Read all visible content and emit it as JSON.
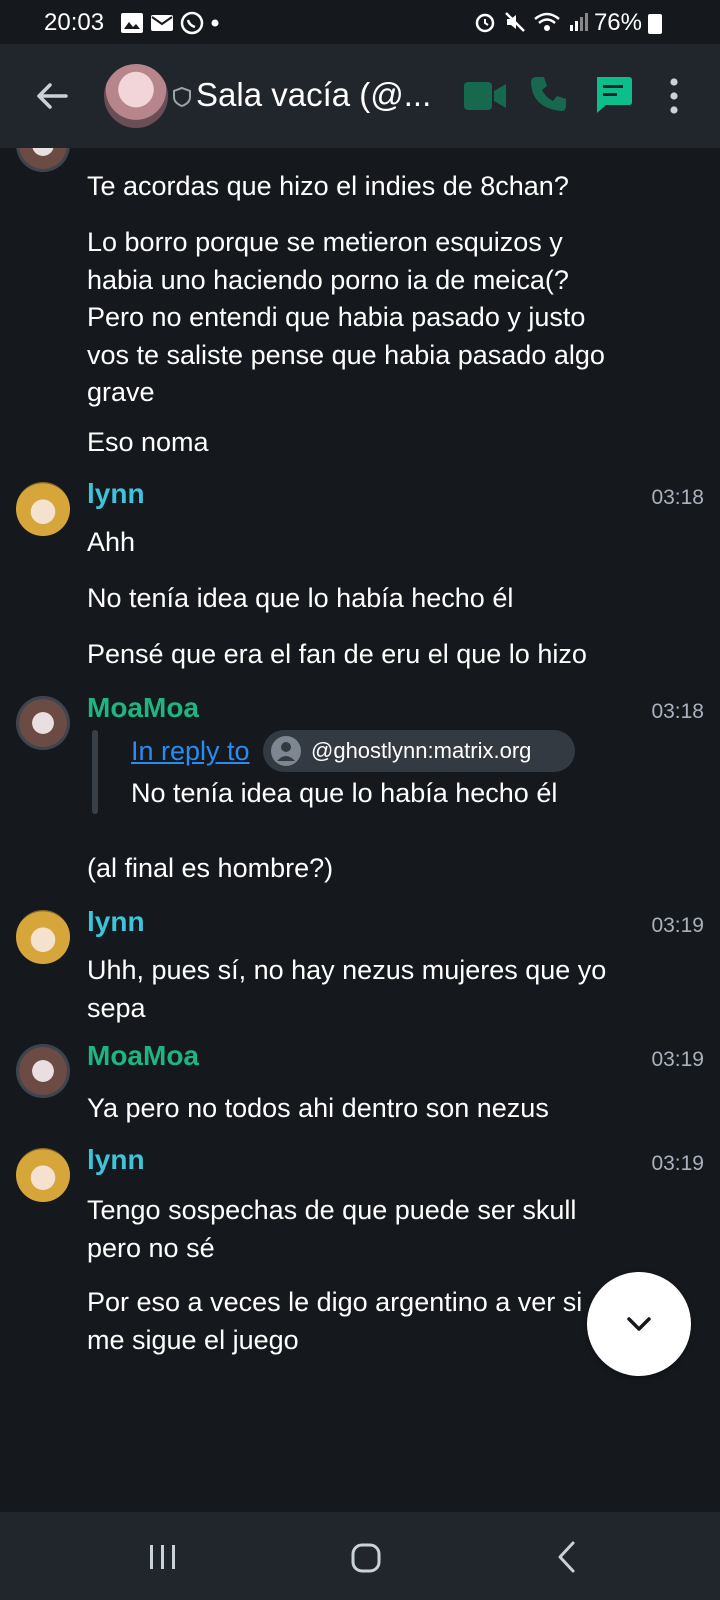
{
  "status_bar": {
    "time": "20:03",
    "battery": "76%"
  },
  "header": {
    "room_title": "Sala vacía (@..."
  },
  "timeline": {
    "partial_message": {
      "lines": [
        "Te acordas que hizo el indies de 8chan?",
        "Lo borro porque se metieron esquizos y habia uno haciendo porno ia de meica(? Pero no entendi que habia pasado y justo vos te saliste pense que habia pasado algo grave",
        "Eso noma"
      ]
    },
    "events": [
      {
        "sender": "lynn",
        "time": "03:18",
        "lines": [
          "Ahh",
          "No tenía idea que lo había hecho él",
          "Pensé que era el fan de eru el que lo hizo"
        ]
      },
      {
        "sender": "MoaMoa",
        "time": "03:18",
        "reply": {
          "label": "In reply to",
          "user": "@ghostlynn:matrix.org",
          "text": "No tenía idea que lo había hecho él"
        },
        "lines": [
          "(al final es hombre?)"
        ]
      },
      {
        "sender": "lynn",
        "time": "03:19",
        "lines": [
          "Uhh, pues sí, no hay nezus mujeres que yo sepa"
        ]
      },
      {
        "sender": "MoaMoa",
        "time": "03:19",
        "lines": [
          "Ya pero no todos ahi dentro son nezus"
        ]
      },
      {
        "sender": "lynn",
        "time": "03:19",
        "lines": [
          "Tengo sospechas de que puede ser skull pero no sé",
          "Por eso a veces le digo argentino a ver si me sigue el juego"
        ]
      }
    ]
  },
  "colors": {
    "lynn": "#3ec3d8",
    "moamoa": "#1fb580",
    "accent_green": "#0dbd8b",
    "link": "#2a8cf0"
  },
  "icons": [
    "back-arrow-icon",
    "shield-icon",
    "video-call-icon",
    "voice-call-icon",
    "threads-icon",
    "more-vert-icon",
    "chevron-down-icon",
    "nav-recents-icon",
    "nav-home-icon",
    "nav-back-icon"
  ]
}
